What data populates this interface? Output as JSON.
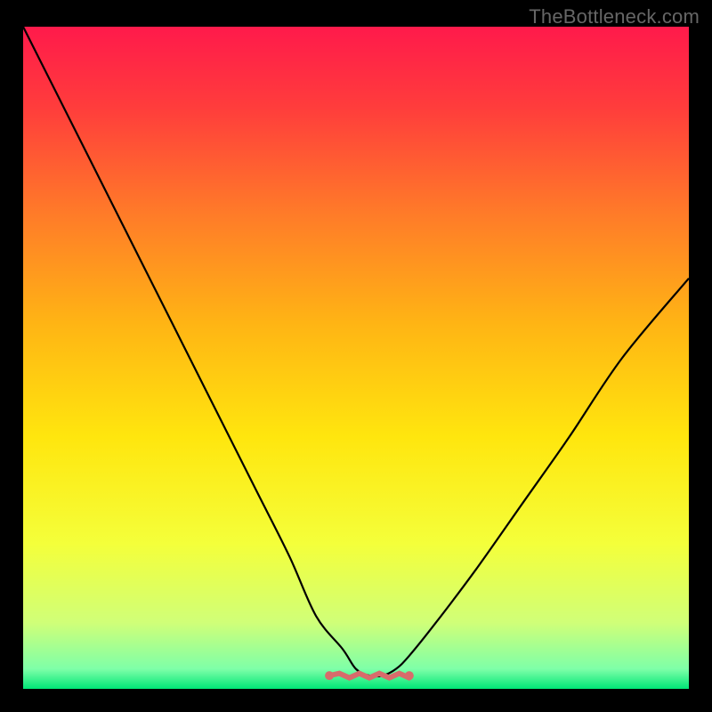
{
  "watermark": "TheBottleneck.com",
  "chart_data": {
    "type": "line",
    "title": "",
    "xlabel": "",
    "ylabel": "",
    "xlim": [
      0,
      100
    ],
    "ylim": [
      0,
      100
    ],
    "grid": false,
    "legend": false,
    "background_gradient": {
      "type": "vertical",
      "stops": [
        {
          "pos": 0.0,
          "color": "#ff1a4b"
        },
        {
          "pos": 0.12,
          "color": "#ff3c3c"
        },
        {
          "pos": 0.28,
          "color": "#ff7a29"
        },
        {
          "pos": 0.45,
          "color": "#ffb514"
        },
        {
          "pos": 0.62,
          "color": "#ffe60e"
        },
        {
          "pos": 0.78,
          "color": "#f4ff3a"
        },
        {
          "pos": 0.9,
          "color": "#d0ff78"
        },
        {
          "pos": 0.97,
          "color": "#7effa8"
        },
        {
          "pos": 1.0,
          "color": "#00e676"
        }
      ]
    },
    "series": [
      {
        "name": "bottleneck-curve",
        "color": "#000000",
        "x": [
          0,
          5,
          10,
          15,
          20,
          25,
          30,
          35,
          40,
          44,
          48,
          50,
          52,
          54,
          56,
          58,
          62,
          68,
          75,
          82,
          90,
          100
        ],
        "y": [
          100,
          90,
          80,
          70,
          60,
          50,
          40,
          30,
          20,
          11,
          6,
          3,
          2,
          2,
          3,
          5,
          10,
          18,
          28,
          38,
          50,
          62
        ]
      }
    ],
    "markers": [
      {
        "name": "flat-region",
        "color": "#d86b6b",
        "shape": "squiggle",
        "x_range": [
          46,
          58
        ],
        "y": 2
      }
    ]
  }
}
